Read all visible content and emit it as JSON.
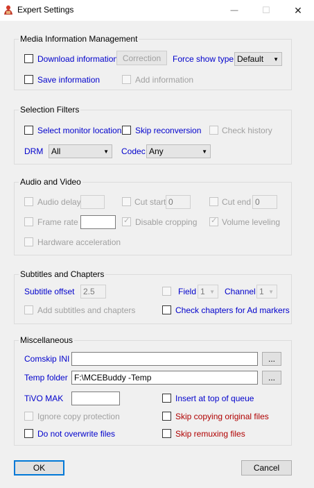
{
  "window": {
    "title": "Expert Settings",
    "icon": "mcebuddy-app-icon",
    "minimize_glyph": "—",
    "maximize_glyph": "☐",
    "close_glyph": "✕"
  },
  "media_info": {
    "group_label": "Media Information Management",
    "download_info": "Download information",
    "correction": "Correction",
    "force_show_type": "Force show type",
    "force_show_type_value": "Default",
    "save_info": "Save information",
    "add_info": "Add information"
  },
  "selection": {
    "group_label": "Selection Filters",
    "select_monitor": "Select monitor locations",
    "skip_reconversion": "Skip reconversion",
    "check_history": "Check history",
    "drm_label": "DRM",
    "drm_value": "All",
    "codec_label": "Codec",
    "codec_value": "Any"
  },
  "audio_video": {
    "group_label": "Audio and Video",
    "audio_delay": "Audio delay",
    "audio_delay_value": "",
    "cut_start": "Cut start",
    "cut_start_value": "0",
    "cut_end": "Cut end",
    "cut_end_value": "0",
    "frame_rate": "Frame rate",
    "frame_rate_value": "",
    "disable_cropping": "Disable cropping",
    "volume_leveling": "Volume leveling",
    "hw_accel": "Hardware acceleration"
  },
  "subtitles": {
    "group_label": "Subtitles and Chapters",
    "subtitle_offset": "Subtitle offset",
    "subtitle_offset_value": "2.5",
    "field_label": "Field",
    "field_value": "1",
    "channel_label": "Channel",
    "channel_value": "1",
    "add_subtitles": "Add subtitles and chapters",
    "check_chapters": "Check chapters for Ad markers"
  },
  "misc": {
    "group_label": "Miscellaneous",
    "comskip_ini": "Comskip INI",
    "comskip_ini_value": "",
    "browse": "...",
    "temp_folder": "Temp folder",
    "temp_folder_value": "F:\\MCEBuddy -Temp",
    "tivo_mak": "TiVO MAK",
    "tivo_mak_value": "",
    "insert_top": "Insert at top of queue",
    "ignore_copy": "Ignore copy protection",
    "skip_copying": "Skip copying original files",
    "no_overwrite": "Do not overwrite files",
    "skip_remuxing": "Skip remuxing files"
  },
  "footer": {
    "ok": "OK",
    "cancel": "Cancel"
  },
  "colors": {
    "accent": "#0078d7",
    "label_blue": "#0000cc",
    "label_red": "#b00000",
    "disabled": "#a0a0a0"
  }
}
